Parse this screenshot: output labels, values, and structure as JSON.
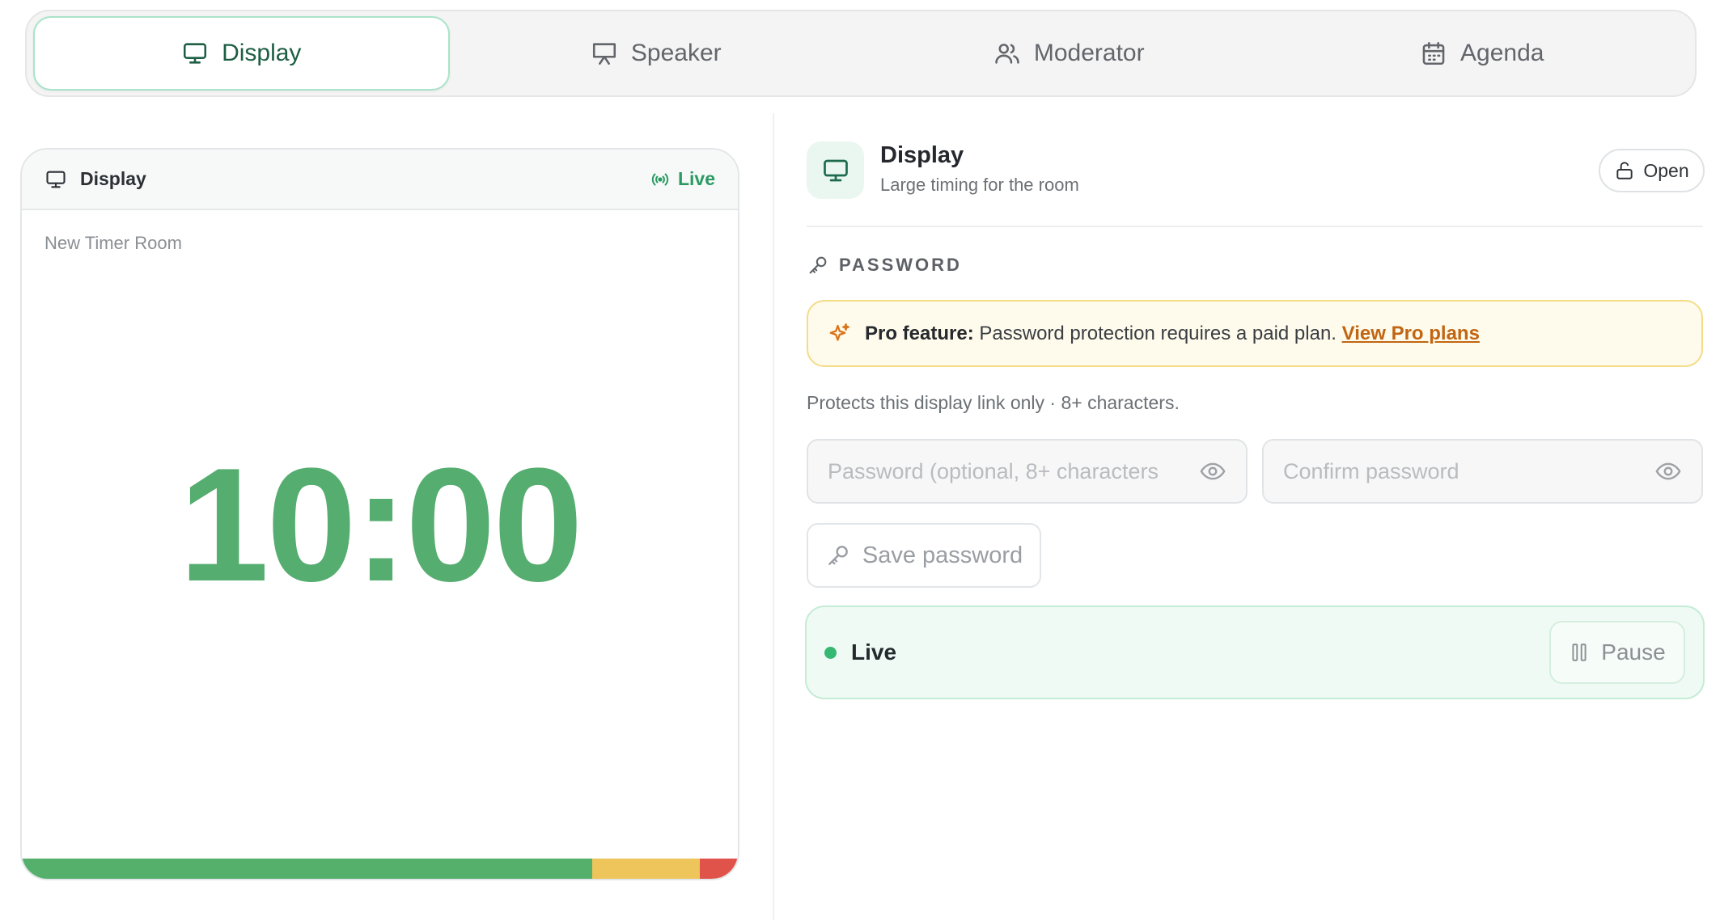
{
  "tabs": [
    {
      "label": "Display",
      "icon": "monitor-icon",
      "active": true
    },
    {
      "label": "Speaker",
      "icon": "presentation-icon",
      "active": false
    },
    {
      "label": "Moderator",
      "icon": "users-icon",
      "active": false
    },
    {
      "label": "Agenda",
      "icon": "calendar-icon",
      "active": false
    }
  ],
  "preview": {
    "title": "Display",
    "live_label": "Live",
    "room_name": "New Timer Room",
    "timer": "10:00",
    "progress": [
      {
        "fraction": 0.797,
        "color": "#55b06c"
      },
      {
        "fraction": 0.15,
        "color": "#eec55b"
      },
      {
        "fraction": 0.053,
        "color": "#e0534a"
      }
    ]
  },
  "panel": {
    "title": "Display",
    "subtitle": "Large timing for the room",
    "open_label": "Open",
    "section_label": "PASSWORD",
    "pro": {
      "bold": "Pro feature:",
      "text": "Password protection requires a paid plan.",
      "link": "View Pro plans"
    },
    "helper": "Protects this display link only · 8+ characters.",
    "password_placeholder": "Password (optional, 8+ characters",
    "confirm_placeholder": "Confirm password",
    "save_label": "Save password",
    "status_label": "Live",
    "pause_label": "Pause"
  },
  "colors": {
    "accent": "#55ad6f",
    "live_green": "#2a9a63",
    "pro_link": "#c26512"
  }
}
